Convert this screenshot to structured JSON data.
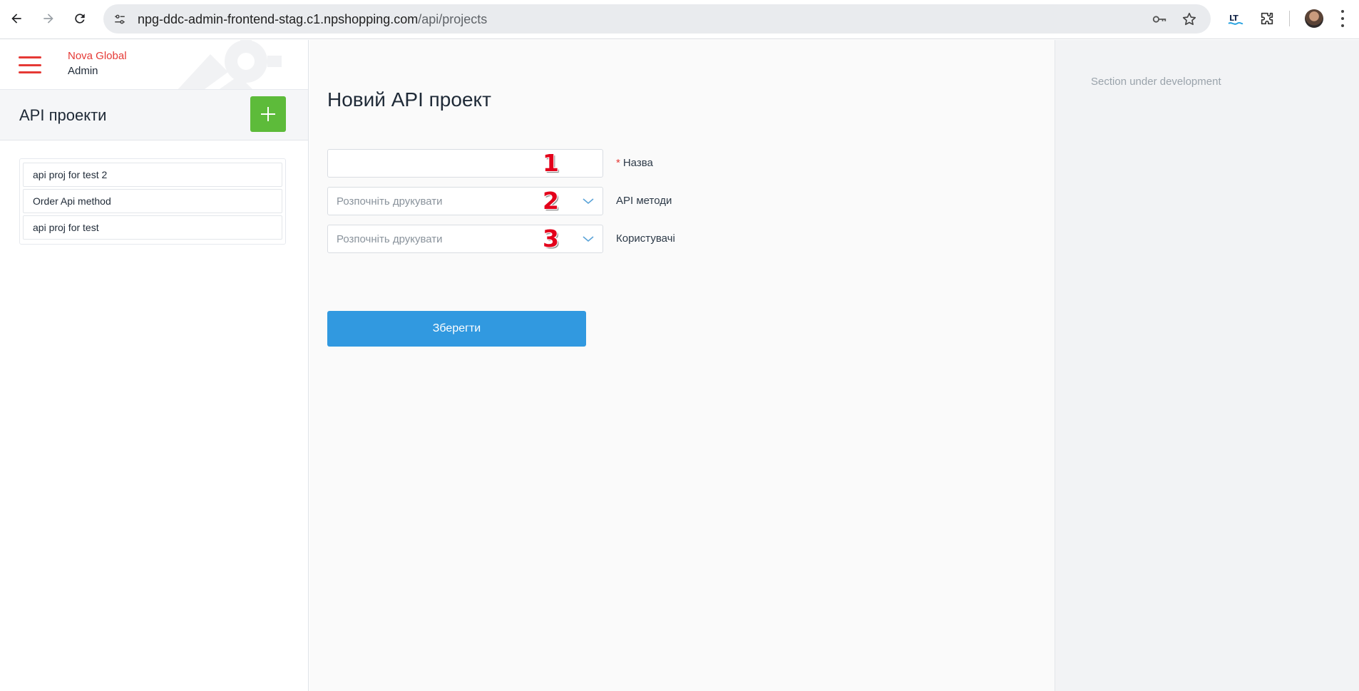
{
  "browser": {
    "url_host": "npg-ddc-admin-frontend-stag.c1.npshopping.com",
    "url_path": "/api/projects",
    "ext_label": "LT"
  },
  "brand": {
    "name": "Nova Global",
    "sub": "Admin",
    "accent": "#e53935"
  },
  "sidebar": {
    "title": "API проекти",
    "add_color": "#5dbb3a",
    "projects": [
      {
        "label": "api proj for test 2"
      },
      {
        "label": "Order Api method"
      },
      {
        "label": "api proj for test"
      }
    ]
  },
  "form": {
    "title": "Новий API проект",
    "fields": [
      {
        "label": "Назва",
        "required": "*",
        "value": "",
        "marker": "1"
      },
      {
        "label": "API методи",
        "placeholder": "Розпочніть друкувати",
        "marker": "2"
      },
      {
        "label": "Користувачі",
        "placeholder": "Розпочніть друкувати",
        "marker": "3"
      }
    ],
    "save_label": "Зберегти",
    "save_color": "#3199e0"
  },
  "right_panel": {
    "note": "Section under development"
  }
}
